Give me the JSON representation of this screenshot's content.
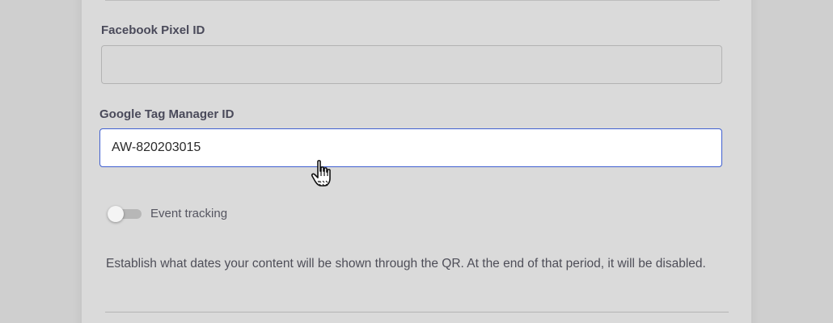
{
  "form": {
    "facebook_pixel": {
      "label": "Facebook Pixel ID",
      "value": ""
    },
    "google_tag_manager": {
      "label": "Google Tag Manager ID",
      "value": "AW-820203015"
    },
    "event_tracking": {
      "label": "Event tracking",
      "enabled": false
    },
    "date_description": "Establish what dates your content will be shown through the QR. At the end of that period, it will be disabled."
  },
  "colors": {
    "background": "#cfcfcf",
    "card": "#dadada",
    "focus_border": "#3f5fd0",
    "label_text": "#4a4a5a"
  },
  "icons": {
    "cursor": "hand-pointer-icon"
  }
}
